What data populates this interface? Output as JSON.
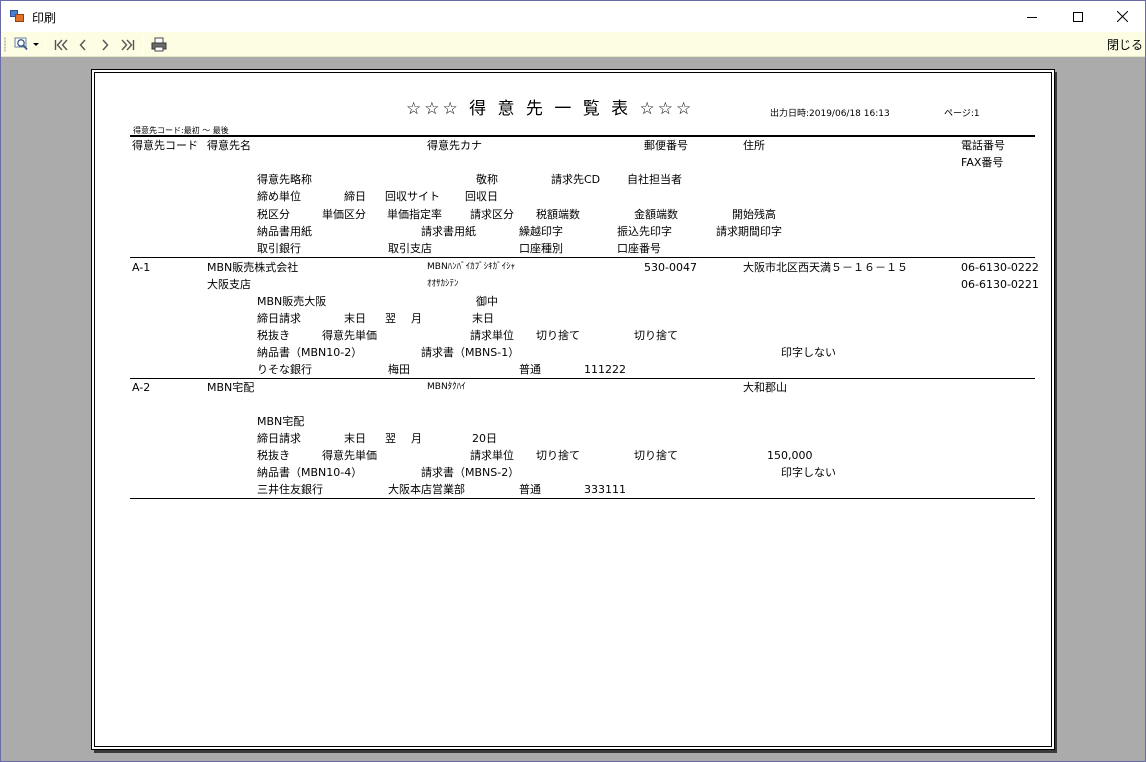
{
  "window": {
    "title": "印刷",
    "close_label": "閉じる"
  },
  "toolbar": {
    "icons": [
      "zoom-icon",
      "dropdown-arrow-icon",
      "first-page-icon",
      "prev-page-icon",
      "next-page-icon",
      "last-page-icon",
      "print-icon"
    ]
  },
  "report": {
    "title": "☆☆☆ 得 意 先 一 覧 表 ☆☆☆",
    "output_datetime": "出力日時:2019/06/18 16:13",
    "page_label": "ページ:1",
    "range": "得意先コード:最初 ～ 最後",
    "headers": {
      "line1": {
        "code": "得意先コード",
        "name": "得意先名",
        "kana": "得意先カナ",
        "postal": "郵便番号",
        "address": "住所",
        "tel": "電話番号"
      },
      "line2": {
        "fax": "FAX番号"
      },
      "line3": {
        "short_name": "得意先略称",
        "honorific": "敬称",
        "billing_cd": "請求先CD",
        "staff": "自社担当者"
      },
      "line4": {
        "closing_unit": "締め単位",
        "closing_day": "締日",
        "collection_site": "回収サイト",
        "collection_day": "回収日"
      },
      "line5": {
        "tax_class": "税区分",
        "price_class": "単価区分",
        "price_rate": "単価指定率",
        "billing_class": "請求区分",
        "tax_rounding": "税額端数",
        "amount_rounding": "金額端数",
        "opening_balance": "開始残高"
      },
      "line6": {
        "delivery_form": "納品書用紙",
        "invoice_form": "請求書用紙",
        "carryover_print": "繰越印字",
        "transfer_print": "振込先印字",
        "period_print": "請求期間印字"
      },
      "line7": {
        "bank": "取引銀行",
        "branch": "取引支店",
        "account_type": "口座種別",
        "account_no": "口座番号"
      }
    },
    "records": [
      {
        "code": "A-1",
        "name": "MBN販売株式会社",
        "kana": "MBNﾊﾝﾊﾞｲｶﾌﾞｼｷｶﾞｲｼｬ",
        "postal": "530-0047",
        "address": "大阪市北区西天満５－１６－１５",
        "tel": "06-6130-0222",
        "name2": "大阪支店",
        "kana2": "ｵｵｻｶｼﾃﾝ",
        "fax": "06-6130-0221",
        "short_name": "MBN販売大阪",
        "honorific": "御中",
        "closing_unit": "締日請求",
        "closing_day": "末日",
        "collection_site_a": "翌",
        "collection_site_b": "月",
        "collection_day": "末日",
        "tax_class": "税抜き",
        "price_class": "得意先単価",
        "billing_class": "請求単位",
        "tax_rounding": "切り捨て",
        "amount_rounding": "切り捨て",
        "opening_balance": "",
        "delivery_form": "納品書（MBN10-2）",
        "invoice_form": "請求書（MBNS-1）",
        "period_print": "印字しない",
        "bank": "りそな銀行",
        "branch": "梅田",
        "account_type": "普通",
        "account_no": "111222"
      },
      {
        "code": "A-2",
        "name": "MBN宅配",
        "kana": "MBNﾀｸﾊｲ",
        "postal": "",
        "address": "大和郡山",
        "tel": "",
        "name2": "",
        "kana2": "",
        "fax": "",
        "short_name": "MBN宅配",
        "honorific": "",
        "closing_unit": "締日請求",
        "closing_day": "末日",
        "collection_site_a": "翌",
        "collection_site_b": "月",
        "collection_day": "20日",
        "tax_class": "税抜き",
        "price_class": "得意先単価",
        "billing_class": "請求単位",
        "tax_rounding": "切り捨て",
        "amount_rounding": "切り捨て",
        "opening_balance": "150,000",
        "delivery_form": "納品書（MBN10-4）",
        "invoice_form": "請求書（MBNS-2）",
        "period_print": "印字しない",
        "bank": "三井住友銀行",
        "branch": "大阪本店営業部",
        "account_type": "普通",
        "account_no": "333111"
      }
    ]
  }
}
